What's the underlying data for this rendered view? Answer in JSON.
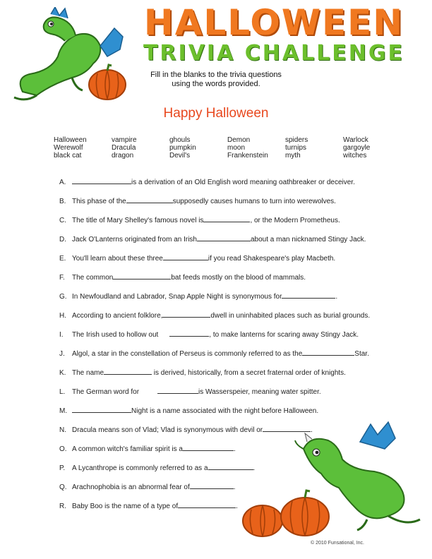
{
  "header": {
    "title_line1": "HALLOWEEN",
    "title_line2": "TRIVIA CHALLENGE",
    "instructions_line1": "Fill in the blanks to the trivia questions",
    "instructions_line2": "using the words provided.",
    "subtitle": "Happy Halloween"
  },
  "word_bank": [
    [
      "Halloween",
      "Werewolf",
      "black cat"
    ],
    [
      "vampire",
      "Dracula",
      "dragon"
    ],
    [
      "ghouls",
      "pumpkin",
      "Devil's"
    ],
    [
      "Demon",
      "moon",
      "Frankenstein"
    ],
    [
      "spiders",
      "turnips",
      "myth"
    ],
    [
      "Warlock",
      "gargoyle",
      "witches"
    ]
  ],
  "questions": [
    {
      "letter": "A.",
      "before": "",
      "after": "is a derivation of an Old English word meaning oathbreaker or deceiver."
    },
    {
      "letter": "B.",
      "before": "This phase of the",
      "after": "supposedly causes humans to turn into werewolves."
    },
    {
      "letter": "C.",
      "before": "The title of Mary Shelley's famous novel is",
      "after": ", or the Modern Prometheus."
    },
    {
      "letter": "D.",
      "before": "Jack O'Lanterns originated from an Irish",
      "after": "about a man nicknamed Stingy Jack."
    },
    {
      "letter": "E.",
      "before": "You'll learn about these three",
      "after": "if you read Shakespeare's play Macbeth."
    },
    {
      "letter": "F.",
      "before": "The common",
      "after": "bat feeds mostly on the blood of mammals."
    },
    {
      "letter": "G.",
      "before": "In Newfoudland and Labrador, Snap Apple Night is synonymous for",
      "after": "."
    },
    {
      "letter": "H.",
      "before": "According to ancient folklore,",
      "after": "dwell in uninhabited places such as burial grounds."
    },
    {
      "letter": "I.",
      "before": "The Irish used to hollow out",
      "after": ", to make lanterns for scaring away Stingy Jack."
    },
    {
      "letter": "J.",
      "before": "Algol, a star in the constellation of Perseus is commonly referred to as the",
      "after": "Star."
    },
    {
      "letter": "K.",
      "before": "The name",
      "after": " is derived, historically, from a secret fraternal order of knights."
    },
    {
      "letter": "L.",
      "before": "The German word for",
      "after": "is Wasserspeier, meaning water spitter."
    },
    {
      "letter": "M.",
      "before": "",
      "after": "Night is a name associated with the night before Halloween."
    },
    {
      "letter": "N.",
      "before": "Dracula means son of Vlad; Vlad is synonymous with devil or",
      "after": "."
    },
    {
      "letter": "O.",
      "before": "A common witch's familiar spirit is a",
      "after": "."
    },
    {
      "letter": "P.",
      "before": "A Lycanthrope is commonly referred to as a",
      "after": "."
    },
    {
      "letter": "Q.",
      "before": "Arachnophobia is an abnormal fear of",
      "after": "."
    },
    {
      "letter": "R.",
      "before": "Baby Boo is the name of a type of",
      "after": "."
    }
  ],
  "footer": {
    "copyright": "© 2010 Funsational, Inc."
  },
  "colors": {
    "title_orange": "#f07820",
    "title_green": "#6cbf2c",
    "subtitle_red": "#e8481e",
    "dragon_green": "#5cbf3a",
    "pumpkin_orange": "#e8621a"
  },
  "icons": [
    "dragon-illustration",
    "pumpkin-illustration"
  ]
}
